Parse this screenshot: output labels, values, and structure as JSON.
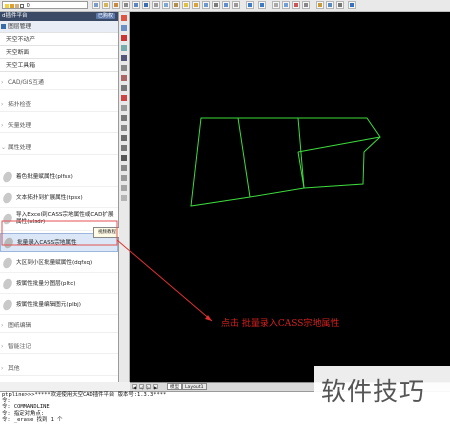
{
  "toolbar": {
    "layer_value": "0",
    "icons": [
      "layer-props-icon",
      "save-icon",
      "match-icon",
      "undo-icon",
      "redo-icon",
      "zoom-icon",
      "pan-icon",
      "grid-icon",
      "help-icon"
    ]
  },
  "panel": {
    "title": "d插件平台",
    "corner_button": "已购权",
    "sections": [
      {
        "label": "图层管理",
        "expanded": true
      },
      {
        "label": "天空不动产"
      },
      {
        "label": "天空断面"
      },
      {
        "label": "天空工具箱"
      }
    ],
    "subgroups": [
      "CAD/GIS互通",
      "拓扑检查",
      "矢量处理",
      "属性处理"
    ],
    "commands": [
      "着色批量赋属性(plfsx)",
      "文本拓扑到扩展属性(tpsx)",
      "导入Excel到CASS宗地属性或CAD扩展属性(xlsdr)",
      "批量录入CASS宗地属性",
      "大区到小区批量赋属性(dqfxq)",
      "按属性批量分图层(pltc)",
      "按属性批量编辑图元(plbj)"
    ],
    "selected_command_index": 3,
    "tooltip": "视频教程",
    "bottom_groups": [
      "图纸编辑",
      "智能注记",
      "其他"
    ]
  },
  "layout_tabs": {
    "model": "模型",
    "layout": "Layout1"
  },
  "annotation": "点击 批量录入CASS宗地属性",
  "watermark": "软件技巧",
  "command_line": [
    "ptpline>>>*****欢迎使用天空CAD插件平台 版本号:1.3.3****",
    "令:",
    "令: COMMANDLINE",
    "令: 指定对角点:",
    "令: _erase 找到 1 个"
  ],
  "colors": {
    "canvas_bg": "#000000",
    "parcel_line": "#3ddc3d",
    "annotation": "#d82020",
    "panel_header": "#3a4a66"
  }
}
